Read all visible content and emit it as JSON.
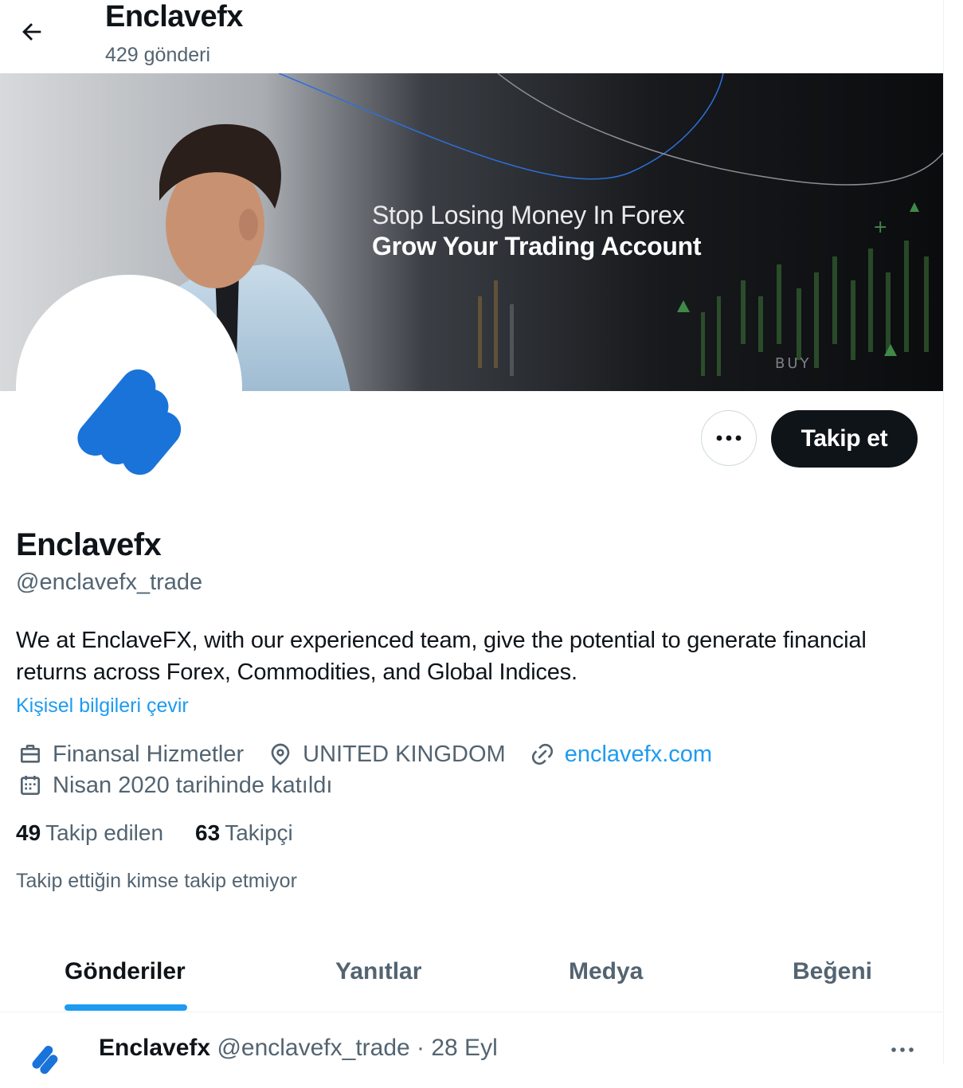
{
  "header": {
    "back_icon": "arrow-left-icon",
    "title": "Enclavefx",
    "subtitle": "429 gönderi"
  },
  "banner": {
    "line1": "Stop Losing Money In Forex",
    "line2": "Grow Your Trading Account",
    "buy_label": "BUY"
  },
  "actions": {
    "more_icon": "ellipsis-icon",
    "follow_label": "Takip et"
  },
  "profile": {
    "name": "Enclavefx",
    "handle": "@enclavefx_trade",
    "bio": "We at EnclaveFX, with our experienced team, give the potential to generate financial returns across Forex, Commodities, and Global Indices.",
    "translate_label": "Kişisel bilgileri çevir",
    "category": "Finansal Hizmetler",
    "location": "UNITED KINGDOM",
    "website": "enclavefx.com",
    "joined": "Nisan 2020 tarihinde katıldı"
  },
  "stats": {
    "following_count": "49",
    "following_label": "Takip edilen",
    "followers_count": "63",
    "followers_label": "Takipçi",
    "followed_by": "Takip ettiğin kimse takip etmiyor"
  },
  "tabs": [
    {
      "label": "Gönderiler",
      "active": true
    },
    {
      "label": "Yanıtlar",
      "active": false
    },
    {
      "label": "Medya",
      "active": false
    },
    {
      "label": "Beğeni",
      "active": false
    }
  ],
  "post": {
    "name": "Enclavefx",
    "meta": "@enclavefx_trade · 28 Eyl"
  },
  "colors": {
    "accent": "#1d9bf0",
    "text": "#0f1419",
    "secondary": "#536471",
    "logo_blue": "#1a73d9"
  }
}
